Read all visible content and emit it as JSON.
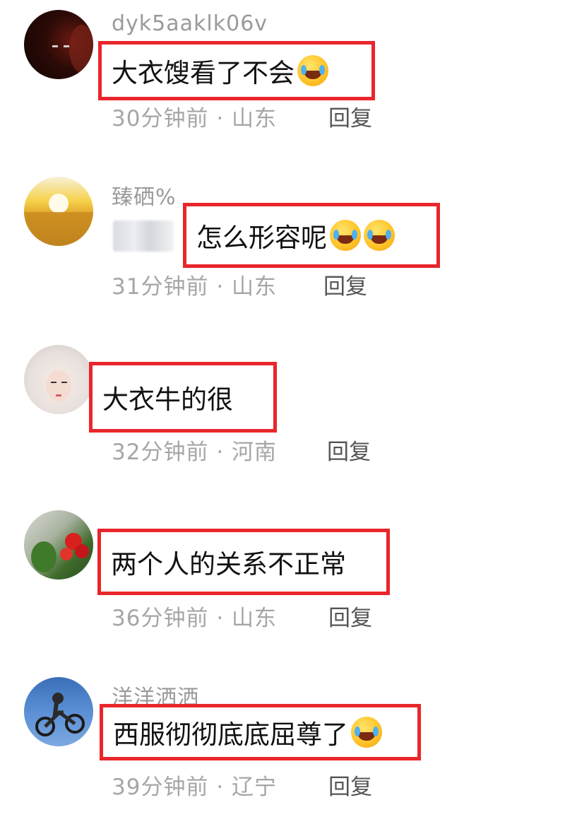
{
  "comments": [
    {
      "username": "dyk5aaklk06v",
      "text": "大衣馊看了不会",
      "emoji_count": 1,
      "time": "30分钟前",
      "location": "山东",
      "reply_label": "回复",
      "avatar_icon": "dark-portrait-icon"
    },
    {
      "username": "臻硒%",
      "text": "怎么形容呢",
      "emoji_count": 2,
      "time": "31分钟前",
      "location": "山东",
      "reply_label": "回复",
      "avatar_icon": "sunrise-field-icon"
    },
    {
      "username": "",
      "text": "大衣牛的很",
      "emoji_count": 0,
      "time": "32分钟前",
      "location": "河南",
      "reply_label": "回复",
      "avatar_icon": "girl-portrait-icon"
    },
    {
      "username": "",
      "text": "两个人的关系不正常",
      "emoji_count": 0,
      "time": "36分钟前",
      "location": "山东",
      "reply_label": "回复",
      "avatar_icon": "flowers-icon"
    },
    {
      "username": "洋洋洒洒",
      "text": "西服彻彻底底屈尊了",
      "emoji_count": 1,
      "time": "39分钟前",
      "location": "辽宁",
      "reply_label": "回复",
      "avatar_icon": "motocross-icon"
    }
  ],
  "separator": "·",
  "colors": {
    "highlight_border": "#e8262b",
    "username": "#9a9a9a",
    "meta": "#a6a6a6"
  }
}
